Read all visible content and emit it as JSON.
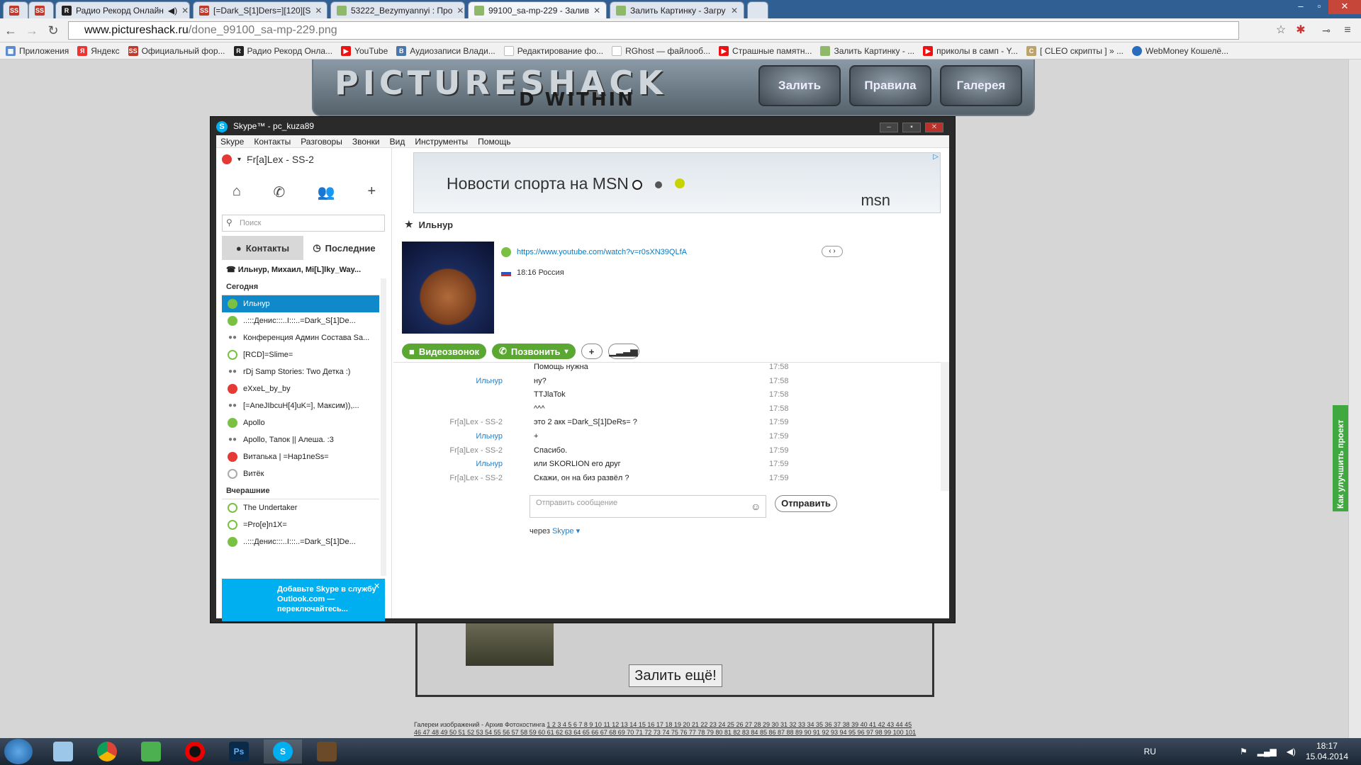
{
  "browser": {
    "tabs": [
      {
        "title": "",
        "icon": "ss-favicon"
      },
      {
        "title": "",
        "icon": "ss-favicon"
      },
      {
        "title": "Радио Рекорд Онлайн",
        "icon": "record-favicon"
      },
      {
        "title": "[=Dark_S[1]Ders=][120][S",
        "icon": "ss-favicon"
      },
      {
        "title": "53222_Bezymyannyi : Про",
        "icon": "image-favicon"
      },
      {
        "title": "99100_sa-mp-229 - Залив",
        "icon": "image-favicon"
      },
      {
        "title": "Залить Картинку - Загру",
        "icon": "image-favicon"
      }
    ],
    "url": "www.pictureshack.ru/done_99100_sa-mp-229.png",
    "url_host": "www.pictureshack.ru",
    "url_path": "/done_99100_sa-mp-229.png",
    "bookmarks": [
      {
        "label": "Приложения",
        "icon": "apps-icon"
      },
      {
        "label": "Яндекс",
        "icon": "yandex-icon"
      },
      {
        "label": "Официальный фор...",
        "icon": "ss-icon"
      },
      {
        "label": "Радио Рекорд Онла...",
        "icon": "record-icon"
      },
      {
        "label": "YouTube",
        "icon": "youtube-icon"
      },
      {
        "label": "Аудиозаписи Влади...",
        "icon": "vk-icon"
      },
      {
        "label": "Редактирование фо...",
        "icon": "page-icon"
      },
      {
        "label": "RGhost — файлооб...",
        "icon": "rghost-icon"
      },
      {
        "label": "Страшные памятн...",
        "icon": "youtube-icon"
      },
      {
        "label": "Залить Картинку - ...",
        "icon": "image-icon"
      },
      {
        "label": "приколы в самп - Y...",
        "icon": "youtube-icon"
      },
      {
        "label": "[ CLEO скрипты ] » ...",
        "icon": "cleo-icon"
      },
      {
        "label": "WebMoney Кошелё...",
        "icon": "webmoney-icon"
      }
    ]
  },
  "site": {
    "logo": "PICTURESHACK",
    "logo_sub": "D WITHIN",
    "nav": [
      "Залить",
      "Правила",
      "Галерея"
    ],
    "upload_more": "Залить ещё!",
    "gallery_prefix": "Галереи изображений - Архив Фотохостинга",
    "gallery_pages_1": "1 2 3 4 5 6 7 8 9 10 11 12 13 14 15 16 17 18 19 20 21 22 23 24 25 26 27 28 29 30 31 32 33 34 35 36 37 38 39 40 41 42 43 44 45",
    "gallery_pages_2": "46 47 48 49 50 51 52 53 54 55 56 57 58 59 60 61 62 63 64 65 66 67 68 69 70 71 72 73 74 75 76 77 78 79 80 81 82 83 84 85 86 87 88 89 90 91 92 93 94 95 96 97 98 99 100 101",
    "feedback": "Как улучшить проект"
  },
  "skype": {
    "title": "Skype™ - pc_kuza89",
    "menu": [
      "Skype",
      "Контакты",
      "Разговоры",
      "Звонки",
      "Вид",
      "Инструменты",
      "Помощь"
    ],
    "profile_name": "Fr[a]Lex - SS-2",
    "search_placeholder": "Поиск",
    "tab_contacts": "Контакты",
    "tab_recent": "Последние",
    "active_conference": "Ильнур, Михаил, Mi[L]lky_Way...",
    "section_today": "Сегодня",
    "section_yesterday": "Вчерашние",
    "today": [
      {
        "name": "Ильнур",
        "status": "green",
        "selected": true
      },
      {
        "name": "..:::Денис:::..I:::..=Dark_S[1]De...",
        "status": "green"
      },
      {
        "name": "Конференция Админ Состава Sa...",
        "status": "group"
      },
      {
        "name": "[RCD]=Slime=",
        "status": "none"
      },
      {
        "name": "rDj Samp Stories: Two Детка :)",
        "status": "group"
      },
      {
        "name": "eXxeL_by_by",
        "status": "red"
      },
      {
        "name": "[=AneJIbcuH[4]uK=], Максим)),...",
        "status": "group"
      },
      {
        "name": "Apollo",
        "status": "green"
      },
      {
        "name": "Apollo, Тапок || Алеша. :3",
        "status": "group"
      },
      {
        "name": "Витаnька | =Hap1neSs=",
        "status": "red"
      },
      {
        "name": "Витёк",
        "status": "grey"
      }
    ],
    "yesterday": [
      {
        "name": "The Undertaker",
        "status": "none"
      },
      {
        "name": "=Pro[e]n1X=",
        "status": "none"
      },
      {
        "name": "..:::Денис:::..I:::..=Dark_S[1]De...",
        "status": "green"
      }
    ],
    "promo": "Добавьте Skype в службу Outlook.com — переключайтесь...",
    "ad_text": "Новости спорта на MSN",
    "ad_brand": "msn",
    "contact_name": "Ильнур",
    "mood_link": "https://www.youtube.com/watch?v=r0sXN39QLfA",
    "location": "18:16 Россия",
    "btn_video": "Видеозвонок",
    "btn_call": "Позвонить",
    "messages": [
      {
        "who": "",
        "text": "Помощь нужна",
        "time": "17:58",
        "me": false
      },
      {
        "who": "Ильнур",
        "text": "ну?",
        "time": "17:58",
        "me": false
      },
      {
        "who": "",
        "text": "TTJlaTok",
        "time": "17:58",
        "me": false
      },
      {
        "who": "",
        "text": "^^^",
        "time": "17:58",
        "me": false
      },
      {
        "who": "Fr[a]Lex - SS-2",
        "text": "это 2 акк =Dark_S[1]DeRs= ?",
        "time": "17:59",
        "me": true
      },
      {
        "who": "Ильнур",
        "text": "+",
        "time": "17:59",
        "me": false
      },
      {
        "who": "Fr[a]Lex - SS-2",
        "text": "Спасибо.",
        "time": "17:59",
        "me": true
      },
      {
        "who": "Ильнур",
        "text": "или SKORLION его друг",
        "time": "17:59",
        "me": false
      },
      {
        "who": "Fr[a]Lex - SS-2",
        "text": "Скажи, он на биз развёл ?",
        "time": "17:59",
        "me": true
      }
    ],
    "compose_placeholder": "Отправить сообщение",
    "send": "Отправить",
    "via_prefix": "через",
    "via_link": "Skype"
  },
  "taskbar": {
    "lang": "RU",
    "time": "18:17",
    "date": "15.04.2014"
  }
}
